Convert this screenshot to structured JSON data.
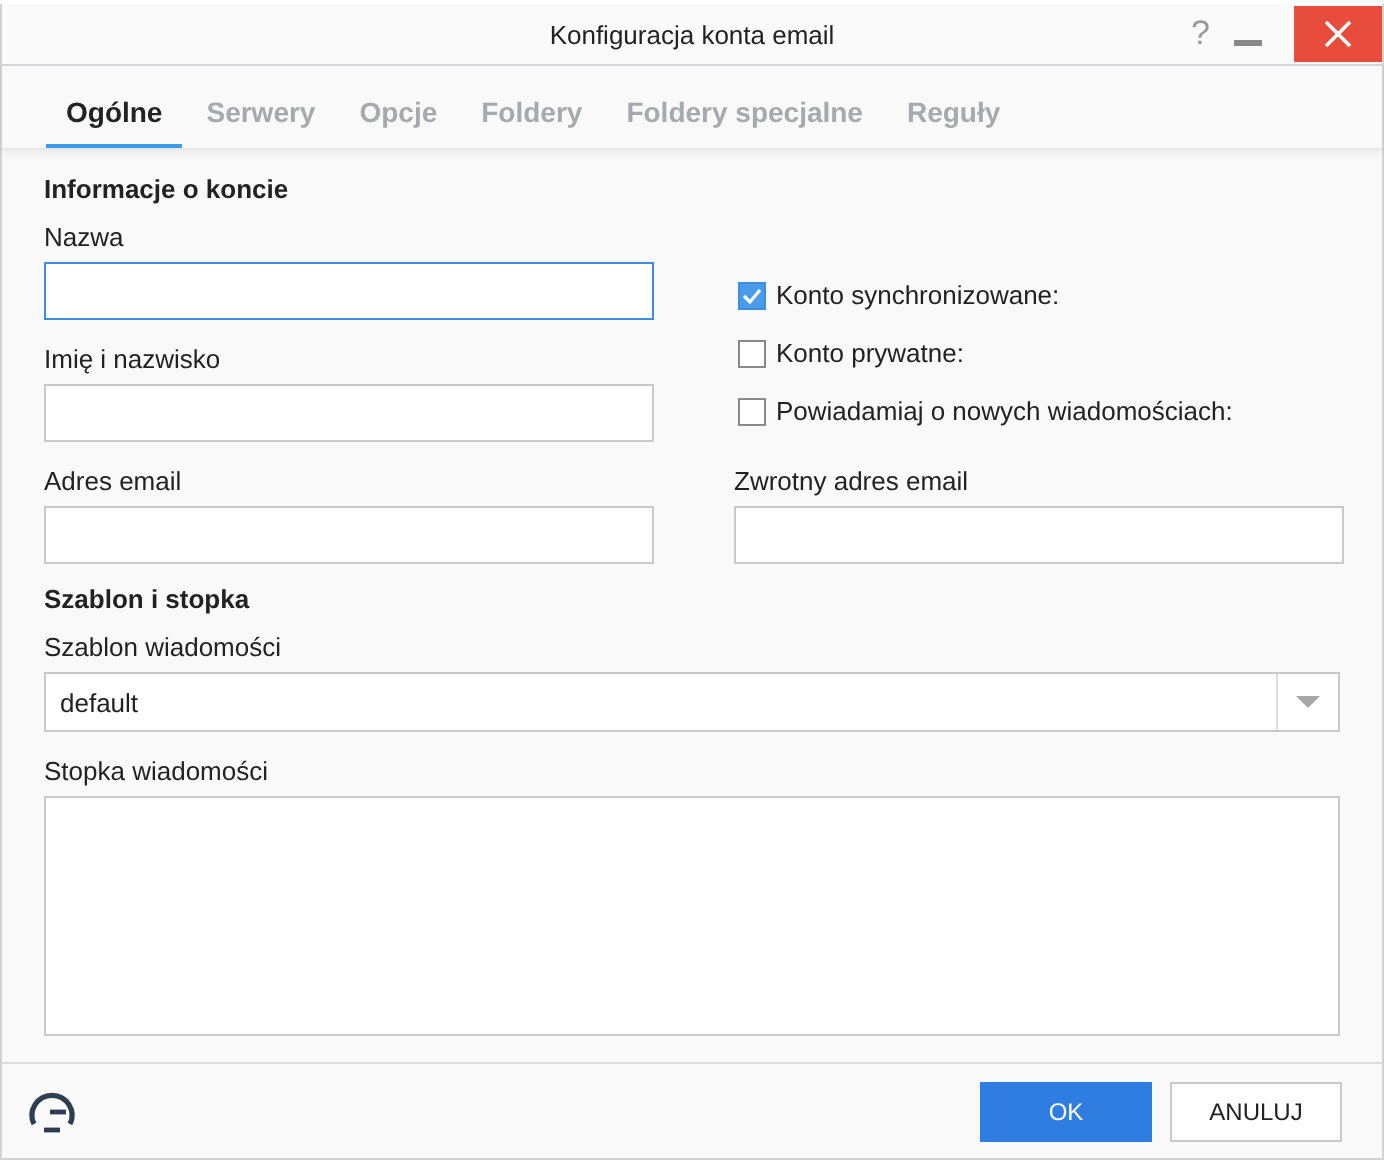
{
  "window": {
    "title": "Konfiguracja konta email",
    "help": "?"
  },
  "tabs": [
    {
      "label": "Ogólne",
      "selected": true
    },
    {
      "label": "Serwery",
      "selected": false
    },
    {
      "label": "Opcje",
      "selected": false
    },
    {
      "label": "Foldery",
      "selected": false
    },
    {
      "label": "Foldery specjalne",
      "selected": false
    },
    {
      "label": "Reguły",
      "selected": false
    }
  ],
  "account_section": {
    "heading": "Informacje o koncie",
    "name_label": "Nazwa",
    "fullname_label": "Imię i nazwisko",
    "email_label": "Adres email",
    "reply_email_label": "Zwrotny adres email",
    "checkboxes": [
      {
        "label": "Konto synchronizowane:",
        "checked": true
      },
      {
        "label": "Konto prywatne:",
        "checked": false
      },
      {
        "label": "Powiadamiaj o nowych wiadomościach:",
        "checked": false
      }
    ]
  },
  "template_section": {
    "heading": "Szablon i stopka",
    "template_label": "Szablon wiadomości",
    "template_value": "default",
    "footer_label": "Stopka wiadomości"
  },
  "buttons": [
    {
      "label": "OK",
      "kind": "primary"
    },
    {
      "label": "ANULUJ",
      "kind": "secondary"
    }
  ]
}
